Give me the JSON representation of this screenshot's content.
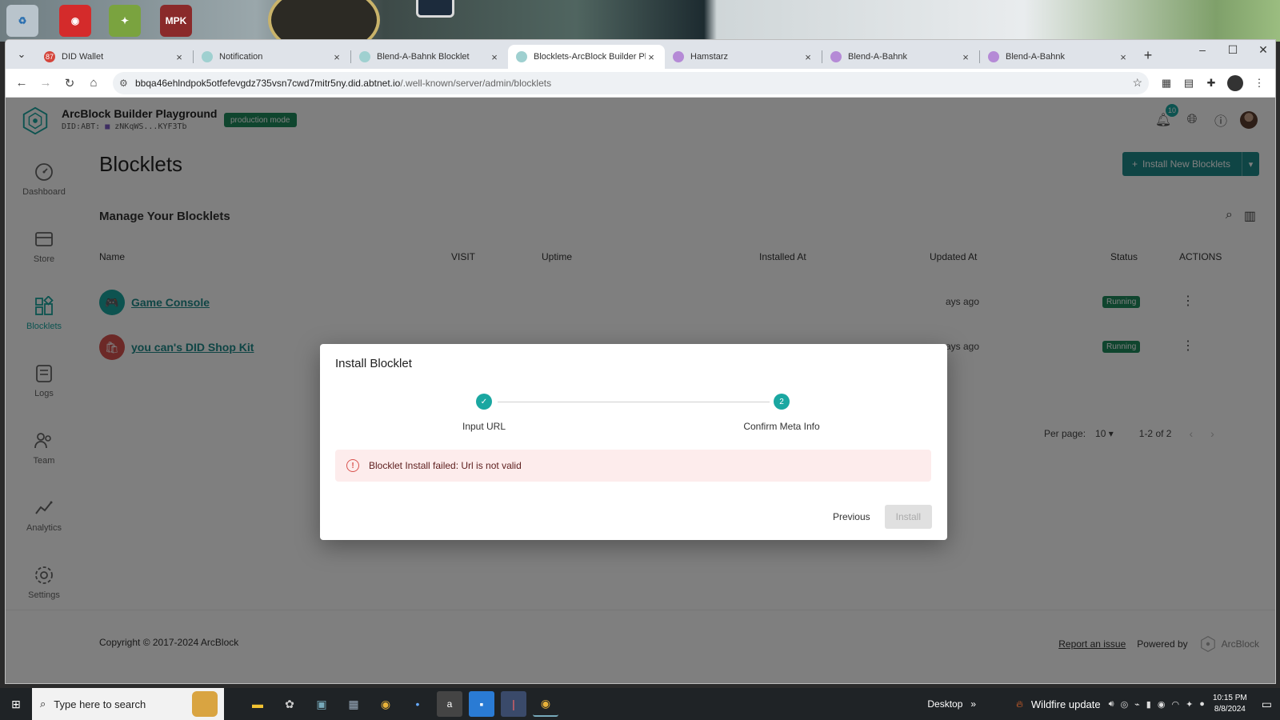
{
  "desktop": {
    "icons": [
      {
        "name": "recycle-bin-icon",
        "color": "#b9c4cc",
        "text": "♻"
      },
      {
        "name": "ccleaner-icon",
        "color": "#d42b2b",
        "text": "◉"
      },
      {
        "name": "fruity-loops-icon",
        "color": "#7aa33f",
        "text": "✦"
      },
      {
        "name": "mpk-icon",
        "color": "#8a2a2a",
        "text": "MPK"
      }
    ]
  },
  "browser": {
    "tabs": [
      {
        "title": "DID Wallet",
        "favicon_color": "#d4453b",
        "favicon": "87",
        "active": false
      },
      {
        "title": "Notification",
        "favicon_color": "#9fd0d0",
        "favicon": "",
        "active": false
      },
      {
        "title": "Blend-A-Bahnk Blocklet",
        "favicon_color": "#9fd0d0",
        "favicon": "",
        "active": false
      },
      {
        "title": "Blocklets-ArcBlock Builder Playground",
        "favicon_color": "#9fd0d0",
        "favicon": "",
        "active": true
      },
      {
        "title": "Hamstarz",
        "favicon_color": "#b58ad6",
        "favicon": "",
        "active": false
      },
      {
        "title": "Blend-A-Bahnk",
        "favicon_color": "#b58ad6",
        "favicon": "",
        "active": false
      },
      {
        "title": "Blend-A-Bahnk",
        "favicon_color": "#b58ad6",
        "favicon": "",
        "active": false
      }
    ],
    "url_host": "bbqa46ehlndpok5otfefevgdz735vsn7cwd7mitr5ny.did.abtnet.io",
    "url_path": "/.well-known/server/admin/blocklets"
  },
  "app": {
    "title": "ArcBlock Builder Playground",
    "did_prefix": "DID:ABT:",
    "did_value": "zNKqWS...KYF3Tb",
    "mode_badge": "production mode",
    "notification_count": "10",
    "accent": "#1aa7a1",
    "sidebar": [
      {
        "label": "Dashboard",
        "icon": "dashboard-icon",
        "active": false
      },
      {
        "label": "Store",
        "icon": "store-icon",
        "active": false
      },
      {
        "label": "Blocklets",
        "icon": "blocklets-icon",
        "active": true
      },
      {
        "label": "Logs",
        "icon": "logs-icon",
        "active": false
      },
      {
        "label": "Team",
        "icon": "team-icon",
        "active": false
      },
      {
        "label": "Analytics",
        "icon": "analytics-icon",
        "active": false
      },
      {
        "label": "Settings",
        "icon": "settings-icon",
        "active": false
      }
    ]
  },
  "main": {
    "heading": "Blocklets",
    "install_button": "Install New Blocklets",
    "section_title": "Manage Your Blocklets",
    "columns": [
      "Name",
      "VISIT",
      "Uptime",
      "Installed At",
      "Updated At",
      "Status",
      "ACTIONS"
    ],
    "rows": [
      {
        "name": "Game Console",
        "updated": "ays ago",
        "status": "Running",
        "icon_color": "#1aa7a1",
        "icon": "🎮"
      },
      {
        "name": "you can's DID Shop Kit",
        "updated": "ays ago",
        "status": "Running",
        "icon_color": "#d9534f",
        "icon": "🛍"
      }
    ],
    "pager": {
      "label": "Per page:",
      "value": "10",
      "range": "1-2 of 2"
    }
  },
  "dialog": {
    "title": "Install Blocklet",
    "steps": [
      {
        "label": "Input URL",
        "state": "done",
        "marker": "✓"
      },
      {
        "label": "Confirm Meta Info",
        "state": "current",
        "marker": "2"
      }
    ],
    "error": "Blocklet Install failed: Url is not valid",
    "previous": "Previous",
    "install": "Install"
  },
  "footer": {
    "copyright": "Copyright © 2017-2024  ArcBlock",
    "report": "Report an issue",
    "powered": "Powered by",
    "brand": "ArcBlock"
  },
  "taskbar": {
    "search_placeholder": "Type here to search",
    "desktop_label": "Desktop",
    "news": "Wildfire update",
    "time": "10:15 PM",
    "date": "8/8/2024"
  }
}
